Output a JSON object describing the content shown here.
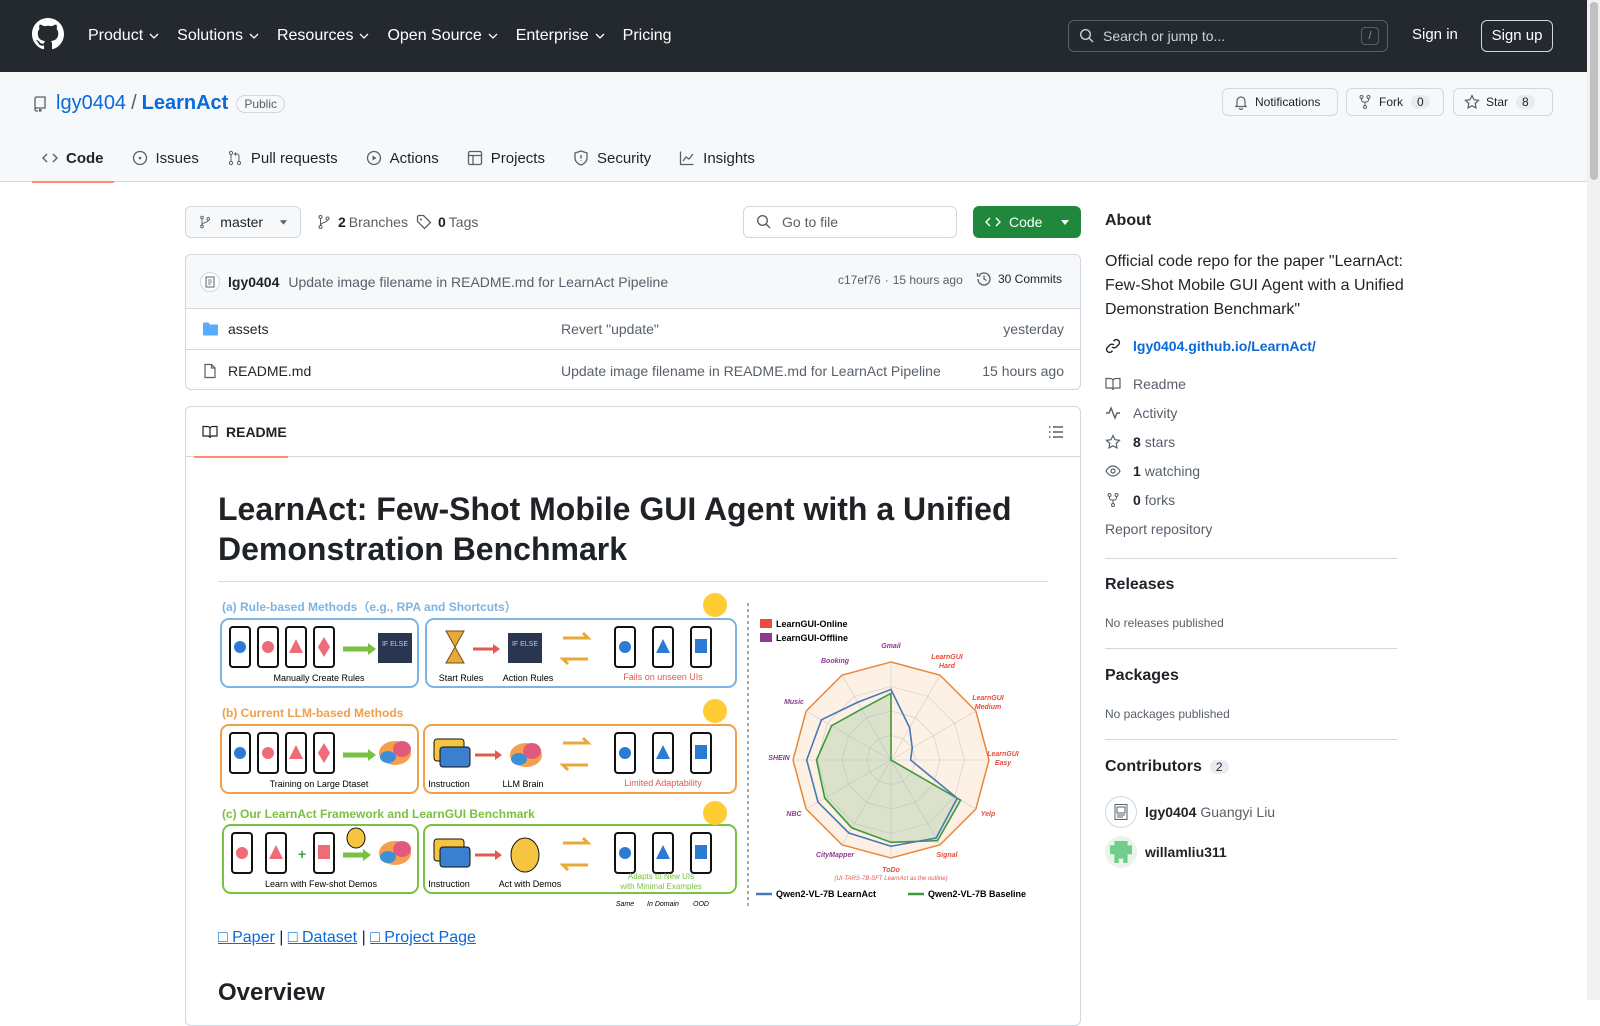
{
  "header": {
    "nav": [
      "Product",
      "Solutions",
      "Resources",
      "Open Source",
      "Enterprise",
      "Pricing"
    ],
    "search_placeholder": "Search or jump to...",
    "search_key": "/",
    "sign_in": "Sign in",
    "sign_up": "Sign up"
  },
  "repo": {
    "owner": "lgy0404",
    "sep": "/",
    "name": "LearnAct",
    "visibility": "Public",
    "notifications": "Notifications",
    "fork": "Fork",
    "fork_count": "0",
    "star": "Star",
    "star_count": "8",
    "tabs": [
      "Code",
      "Issues",
      "Pull requests",
      "Actions",
      "Projects",
      "Security",
      "Insights"
    ]
  },
  "toolbar": {
    "branch": "master",
    "branches_count": "2",
    "branches_label": "Branches",
    "tags_count": "0",
    "tags_label": "Tags",
    "goto": "Go to file",
    "code": "Code"
  },
  "commit": {
    "author": "lgy0404",
    "message": "Update image filename in README.md for LearnAct Pipeline",
    "hash": "c17ef76",
    "time": "15 hours ago",
    "dot": "·",
    "commits": "30 Commits"
  },
  "files": [
    {
      "name": "assets",
      "message": "Revert \"update\"",
      "time": "yesterday"
    },
    {
      "name": "README.md",
      "message": "Update image filename in README.md for LearnAct Pipeline",
      "time": "15 hours ago"
    }
  ],
  "readme": {
    "tab": "README",
    "title": "LearnAct: Few-Shot Mobile GUI Agent with a Unified Demonstration Benchmark",
    "links": [
      "Paper",
      "Dataset",
      "Project Page"
    ],
    "link_sep": "|",
    "overview": "Overview",
    "figure": {
      "a_title": "(a) Rule-based Methods（e.g., RPA and Shortcuts）",
      "a_create": "Manually Create Rules",
      "a_start": "Start Rules",
      "a_action": "Action Rules",
      "a_fail": "Fails on unseen UIs",
      "b_title": "(b) Current LLM-based Methods",
      "b_train": "Training on Large Dtaset",
      "b_instr": "Instruction",
      "b_brain": "LLM Brain",
      "b_limit": "Limited Adaptability",
      "c_title": "(c) Our LearnAct Framework and LearnGUI Benchmark",
      "c_learn": "Learn with Few-shot Demos",
      "c_instr": "Instruction",
      "c_act": "Act with Demos",
      "c_adapt1": "Adapts to New UIs",
      "c_adapt2": "with Minimal Examples",
      "c_same": "Same",
      "c_domain": "In Domain",
      "c_ood": "OOD",
      "ifelse": "IF ELSE",
      "legend_online": "LearnGUI-Online",
      "legend_offline": "LearnGUI-Offline",
      "radar_labels": [
        "Gmail",
        "LearnGUI Hard",
        "LearnGUI Medium",
        "LearnGUI Easy",
        "Yelp",
        "Signal",
        "ToDo",
        "CityMapper",
        "NBC",
        "SHEIN",
        "Music",
        "Booking"
      ],
      "radar_note": "(UI-TARS-7B-SFT LearnAct as the outline)",
      "legend_learnact": "Qwen2-VL-7B LearnAct",
      "legend_baseline": "Qwen2-VL-7B Baseline",
      "radar_learnact": [
        0.72,
        0.38,
        0.25,
        0.2,
        0.78,
        0.92,
        0.88,
        0.86,
        0.86,
        0.86,
        0.82,
        0.68
      ],
      "radar_baseline": [
        0.68,
        0.0,
        0.0,
        0.0,
        0.82,
        0.95,
        0.84,
        0.8,
        0.78,
        0.76,
        0.7,
        0.6
      ],
      "colors": {
        "online": "#e74c3c",
        "offline": "#8e3a8e",
        "learnact": "#4a78b5",
        "baseline": "#3c9a3c",
        "outline": "#e8873a"
      }
    }
  },
  "about": {
    "heading": "About",
    "description": "Official code repo for the paper \"LearnAct: Few-Shot Mobile GUI Agent with a Unified Demonstration Benchmark\"",
    "website": "lgy0404.github.io/LearnAct/",
    "readme": "Readme",
    "activity": "Activity",
    "stars_count": "8",
    "stars_label": "stars",
    "watching_count": "1",
    "watching_label": "watching",
    "forks_count": "0",
    "forks_label": "forks",
    "report": "Report repository"
  },
  "releases": {
    "heading": "Releases",
    "empty": "No releases published"
  },
  "packages": {
    "heading": "Packages",
    "empty": "No packages published"
  },
  "contributors": {
    "heading": "Contributors",
    "count": "2",
    "list": [
      {
        "login": "lgy0404",
        "name": "Guangyi Liu"
      },
      {
        "login": "willamliu311",
        "name": ""
      }
    ]
  }
}
